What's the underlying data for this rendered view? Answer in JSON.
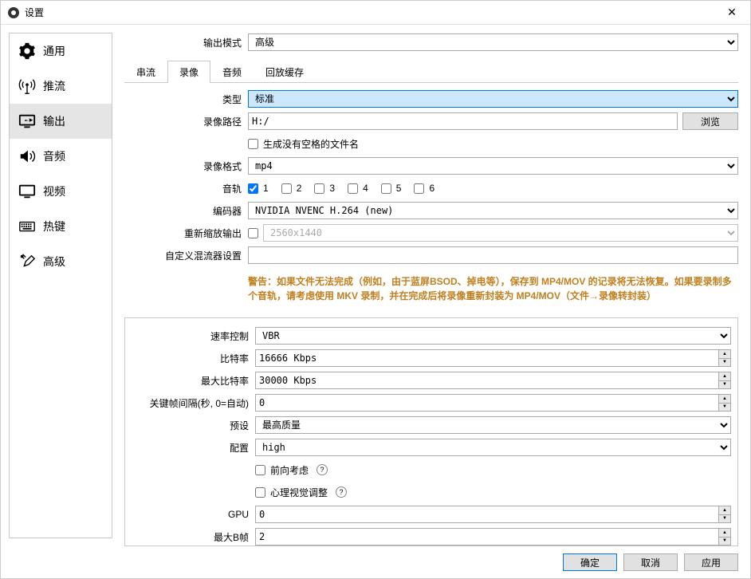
{
  "window": {
    "title": "设置"
  },
  "sidebar": {
    "items": [
      {
        "label": "通用",
        "icon": "gear-icon"
      },
      {
        "label": "推流",
        "icon": "broadcast-icon"
      },
      {
        "label": "输出",
        "icon": "output-icon"
      },
      {
        "label": "音频",
        "icon": "audio-icon"
      },
      {
        "label": "视频",
        "icon": "video-icon"
      },
      {
        "label": "热键",
        "icon": "keyboard-icon"
      },
      {
        "label": "高级",
        "icon": "tools-icon"
      }
    ],
    "active": 2
  },
  "output_mode": {
    "label": "输出模式",
    "value": "高级"
  },
  "tabs": [
    "串流",
    "录像",
    "音频",
    "回放缓存"
  ],
  "active_tab": 1,
  "recording": {
    "type": {
      "label": "类型",
      "value": "标准"
    },
    "path": {
      "label": "录像路径",
      "value": "H:/",
      "browse": "浏览"
    },
    "no_space": {
      "label": "生成没有空格的文件名",
      "checked": false
    },
    "format": {
      "label": "录像格式",
      "value": "mp4"
    },
    "tracks": {
      "label": "音轨",
      "options": [
        "1",
        "2",
        "3",
        "4",
        "5",
        "6"
      ],
      "checked": [
        true,
        false,
        false,
        false,
        false,
        false
      ]
    },
    "encoder": {
      "label": "编码器",
      "value": "NVIDIA NVENC H.264 (new)"
    },
    "rescale": {
      "label": "重新缩放输出",
      "placeholder": "2560x1440",
      "checked": false
    },
    "muxer": {
      "label": "自定义混流器设置",
      "value": ""
    },
    "warning": "警告：如果文件无法完成（例如，由于蓝屏BSOD、掉电等），保存到 MP4/MOV 的记录将无法恢复。如果要录制多个音轨，请考虑使用 MKV 录制，并在完成后将录像重新封装为 MP4/MOV（文件→录像转封装）"
  },
  "encoder": {
    "rate_control": {
      "label": "速率控制",
      "value": "VBR"
    },
    "bitrate": {
      "label": "比特率",
      "value": "16666 Kbps"
    },
    "max_bitrate": {
      "label": "最大比特率",
      "value": "30000 Kbps"
    },
    "keyint": {
      "label": "关键帧间隔(秒, 0=自动)",
      "value": "0"
    },
    "preset": {
      "label": "预设",
      "value": "最高质量"
    },
    "profile": {
      "label": "配置",
      "value": "high"
    },
    "lookahead": {
      "label": "前向考虑",
      "checked": false
    },
    "psycho": {
      "label": "心理视觉调整",
      "checked": false
    },
    "gpu": {
      "label": "GPU",
      "value": "0"
    },
    "max_bframes": {
      "label": "最大B帧",
      "value": "2"
    }
  },
  "footer": {
    "ok": "确定",
    "cancel": "取消",
    "apply": "应用"
  }
}
